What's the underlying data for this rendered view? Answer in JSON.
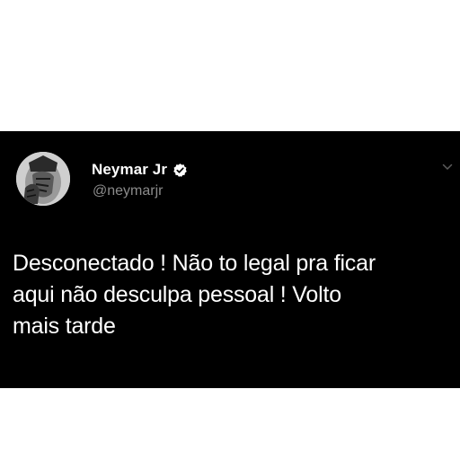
{
  "tweet": {
    "author": {
      "display_name": "Neymar Jr",
      "handle": "@neymarjr",
      "verified": true,
      "avatar_icon": "profile-photo"
    },
    "text": "Desconectado ! Não to legal pra ficar\naqui não desculpa pessoal ! Volto\nmais tarde",
    "menu_icon": "chevron-down-icon"
  },
  "colors": {
    "card_background": "#000000",
    "page_background": "#ffffff",
    "primary_text": "#ffffff",
    "secondary_text": "#8b8b8b",
    "verified_badge": "#ffffff"
  }
}
